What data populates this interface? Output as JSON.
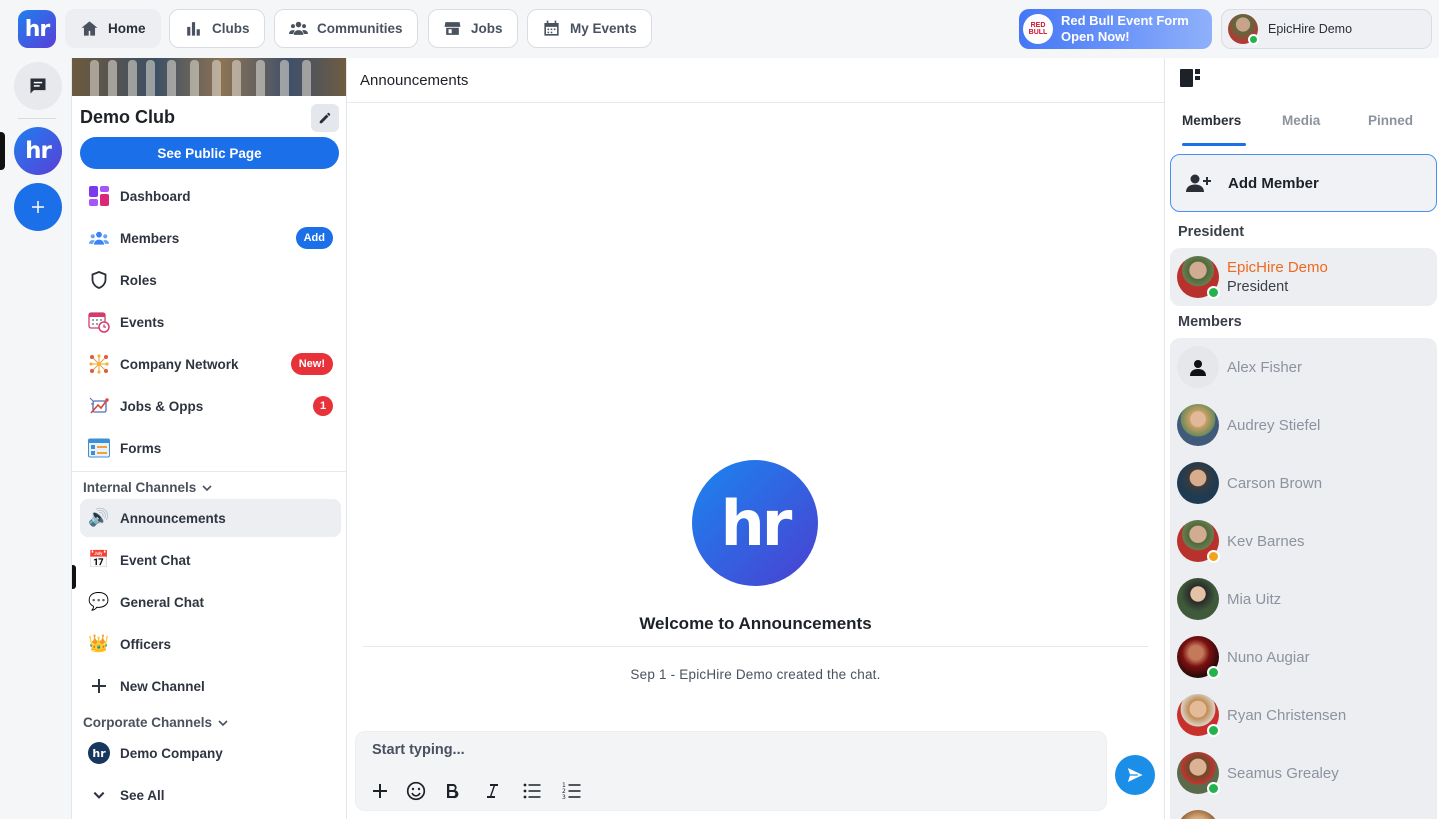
{
  "nav": {
    "home": "Home",
    "clubs": "Clubs",
    "communities": "Communities",
    "jobs": "Jobs",
    "my_events": "My Events"
  },
  "promo": {
    "line1": "Red Bull Event Form",
    "line2": "Open Now!",
    "badge": "Red Bull"
  },
  "user": {
    "name": "EpicHire Demo"
  },
  "club": {
    "name": "Demo Club",
    "public_button": "See Public Page",
    "menu": [
      {
        "label": "Dashboard",
        "icon": "dashboard-icon"
      },
      {
        "label": "Members",
        "icon": "members-icon",
        "badge": "Add"
      },
      {
        "label": "Roles",
        "icon": "shield-icon"
      },
      {
        "label": "Events",
        "icon": "calendar-clock-icon"
      },
      {
        "label": "Company Network",
        "icon": "network-icon",
        "badge": "New!"
      },
      {
        "label": "Jobs & Opps",
        "icon": "jobs-icon",
        "badge": "1"
      },
      {
        "label": "Forms",
        "icon": "forms-icon"
      }
    ],
    "internal_channels": {
      "heading": "Internal Channels",
      "items": [
        {
          "label": "Announcements",
          "emoji": "🔊"
        },
        {
          "label": "Event Chat",
          "emoji": "📅"
        },
        {
          "label": "General Chat",
          "emoji": "💬"
        },
        {
          "label": "Officers",
          "emoji": "👑"
        }
      ],
      "new_channel": "New Channel"
    },
    "corporate_channels": {
      "heading": "Corporate Channels",
      "items": [
        {
          "label": "Demo Company"
        }
      ],
      "see_all": "See All"
    }
  },
  "chat": {
    "channel": "Announcements",
    "welcome": "Welcome to Announcements",
    "created": "Sep 1 - EpicHire Demo created the chat.",
    "placeholder": "Start typing..."
  },
  "panel": {
    "tabs": [
      "Members",
      "Media",
      "Pinned"
    ],
    "add_member": "Add Member",
    "president_heading": "President",
    "president": {
      "name": "EpicHire Demo",
      "role": "President"
    },
    "members_heading": "Members",
    "members": [
      {
        "name": "Alex Fisher",
        "status": "none"
      },
      {
        "name": "Audrey Stiefel",
        "status": "none"
      },
      {
        "name": "Carson Brown",
        "status": "none"
      },
      {
        "name": "Kev Barnes",
        "status": "away"
      },
      {
        "name": "Mia Uitz",
        "status": "none"
      },
      {
        "name": "Nuno Augiar",
        "status": "online"
      },
      {
        "name": "Ryan Christensen",
        "status": "online"
      },
      {
        "name": "Seamus Grealey",
        "status": "online"
      }
    ]
  },
  "colors": {
    "accent": "#1b6fe8",
    "president_name": "#ee6a1f",
    "online": "#22b44a",
    "badge_red": "#e8323a"
  }
}
